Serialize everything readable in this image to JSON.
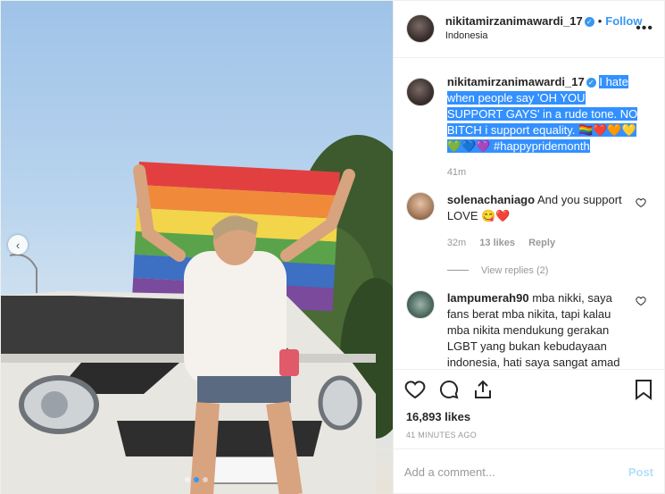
{
  "header": {
    "username": "nikitamirzanimawardi_17",
    "follow_separator": "•",
    "follow_label": "Follow",
    "location": "Indonesia",
    "more_label": "•••"
  },
  "caption": {
    "username": "nikitamirzanimawardi_17",
    "text": "I hate when people say 'OH YOU SUPPORT GAYS' in a rude tone. NO BITCH i support equality. 🏳️‍🌈❤️🧡💛💚💙💜 #happypridemonth",
    "time": "41m"
  },
  "comments": [
    {
      "username": "solenachaniago",
      "text": "And you support LOVE 😋❤️",
      "time": "32m",
      "likes": "13 likes",
      "reply_label": "Reply",
      "view_replies": "View replies (2)"
    },
    {
      "username": "lampumerah90",
      "text": "mba nikki, saya fans berat mba nikita, tapi kalau mba nikita mendukung gerakan LGBT yang bukan kebudayaan indonesia, hati saya sangat amad"
    }
  ],
  "actions": {
    "like_icon": "heart-icon",
    "comment_icon": "comment-icon",
    "share_icon": "share-icon",
    "save_icon": "bookmark-icon"
  },
  "likes": "16,893 likes",
  "timeago": "41 MINUTES AGO",
  "add_comment": {
    "placeholder": "Add a comment...",
    "post_label": "Post"
  },
  "carousel": {
    "arrow": "‹",
    "total_slides": 3,
    "active_slide": 2
  },
  "colors": {
    "accent": "#3897f0",
    "selection": "#3390ff",
    "muted": "#999999",
    "post_disabled": "#b2dffc"
  }
}
